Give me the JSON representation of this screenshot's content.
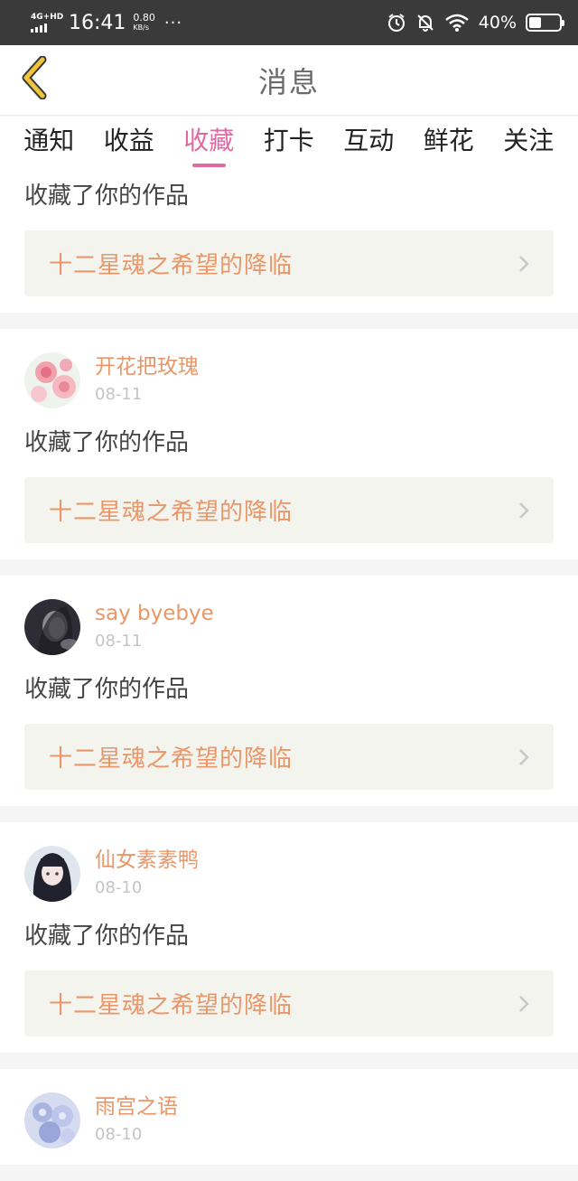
{
  "status_bar": {
    "network": "4G+HD",
    "time": "16:41",
    "speed_value": "0.80",
    "speed_unit": "KB/s",
    "more": "···",
    "battery_percent": "40%",
    "battery_level": 0.4,
    "icons": [
      "signal-icon",
      "alarm-icon",
      "bell-muted-icon",
      "wifi-icon",
      "battery-icon"
    ]
  },
  "nav": {
    "title": "消息",
    "back_icon": "chevron-left-icon"
  },
  "tabs": [
    {
      "label": "通知",
      "active": false
    },
    {
      "label": "收益",
      "active": false
    },
    {
      "label": "收藏",
      "active": true
    },
    {
      "label": "打卡",
      "active": false
    },
    {
      "label": "互动",
      "active": false
    },
    {
      "label": "鲜花",
      "active": false
    },
    {
      "label": "关注",
      "active": false
    }
  ],
  "colors": {
    "accent_pink": "#e26aa3",
    "name_orange": "#e8976a",
    "work_box_bg": "#f4f4ee"
  },
  "feed": [
    {
      "action": "收藏了你的作品",
      "work_title": "十二星魂之希望的降临"
    },
    {
      "user": "开花把玫瑰",
      "date": "08-11",
      "action": "收藏了你的作品",
      "work_title": "十二星魂之希望的降临",
      "avatar_icon": "avatar-roses"
    },
    {
      "user": "say byebye",
      "date": "08-11",
      "action": "收藏了你的作品",
      "work_title": "十二星魂之希望的降临",
      "avatar_icon": "avatar-dark-portrait"
    },
    {
      "user": "仙女素素鸭",
      "date": "08-10",
      "action": "收藏了你的作品",
      "work_title": "十二星魂之希望的降临",
      "avatar_icon": "avatar-anime-girl"
    },
    {
      "user": "雨宫之语",
      "date": "08-10",
      "avatar_icon": "avatar-blue-flowers"
    }
  ]
}
